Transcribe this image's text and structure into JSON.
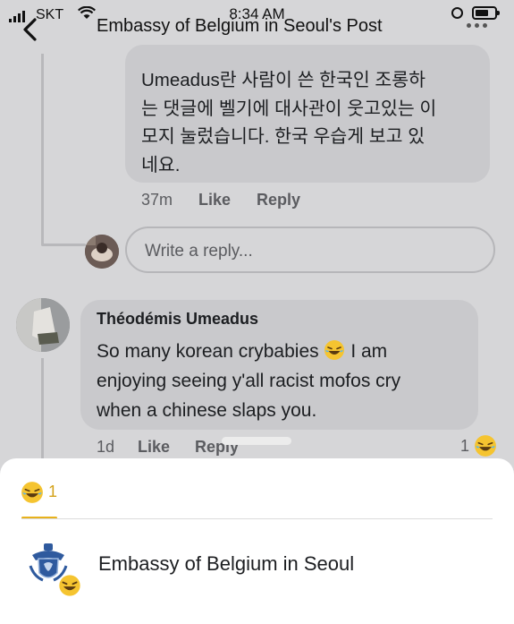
{
  "status_bar": {
    "carrier": "SKT",
    "time": "8:34 AM"
  },
  "nav": {
    "title": "Embassy of Belgium in Seoul's Post"
  },
  "comment_reply": {
    "lines": [
      "Umeadus란 사람이 쓴 한국인 조롱하",
      "는 댓글에 벨기에 대사관이 웃고있는 이",
      "모지 눌렀습니다.  한국 우습게 보고 있",
      "네요."
    ],
    "time": "37m",
    "like": "Like",
    "reply": "Reply"
  },
  "write_reply": {
    "placeholder": "Write a reply..."
  },
  "comment_main": {
    "author": "Théodémis Umeadus",
    "line1_before_emoji": "So many korean crybabies",
    "line1_after_emoji": "I am",
    "line2": "enjoying seeing y'all racist mofos cry",
    "line3": "when a chinese slaps you.",
    "time": "1d",
    "like": "Like",
    "reply": "Reply",
    "reaction_count": "1",
    "reaction_icon": "laughing-emoji"
  },
  "reactions_sheet": {
    "tab": {
      "icon": "laughing-emoji",
      "count": "1"
    },
    "reactors": [
      {
        "name": "Embassy of Belgium in Seoul",
        "reaction_icon": "laughing-emoji"
      }
    ]
  },
  "colors": {
    "accent": "#e8b21c",
    "bubble": "#c9c9cc",
    "background": "#d6d6d8"
  }
}
